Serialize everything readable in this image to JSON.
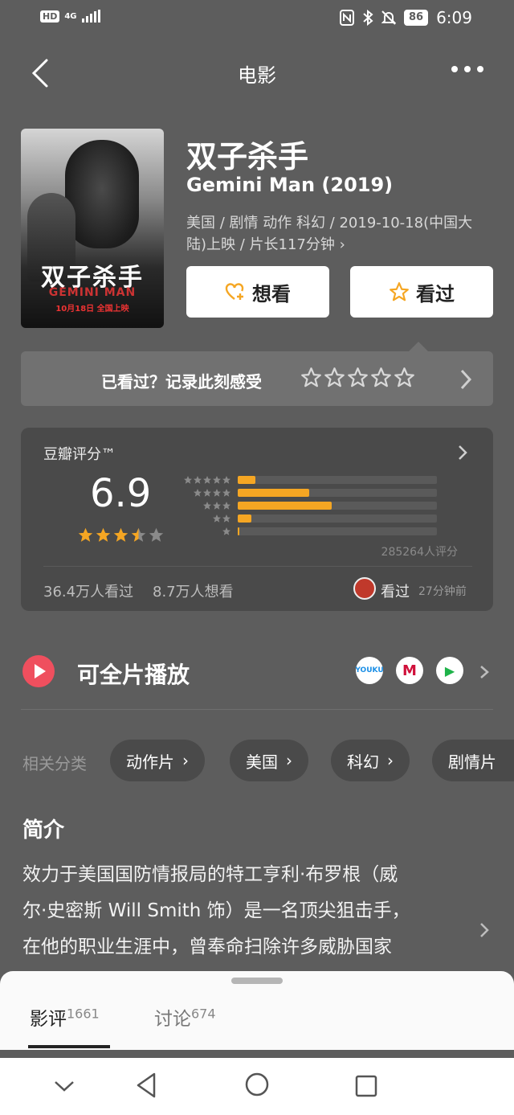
{
  "status_bar": {
    "hd": "HD",
    "network": "4G",
    "battery": "86",
    "time": "6:09"
  },
  "header": {
    "title": "电影"
  },
  "movie": {
    "title": "双子杀手",
    "subtitle": "Gemini Man (2019)",
    "meta_line1": "美国 / 剧情 动作 科幻 / 2019-10-18(中国大",
    "meta_line2": "陆)上映 / 片长117分钟 ›",
    "poster": {
      "title_cn": "双子杀手",
      "title_en": "GEMINI MAN",
      "date": "10月18日 全国上映"
    }
  },
  "actions": {
    "want_label": "想看",
    "seen_label": "看过"
  },
  "feel_bar": {
    "text": "已看过？记录此刻感受"
  },
  "rating": {
    "label": "豆瓣评分™",
    "score": "6.9",
    "star_level": 3.5,
    "distribution": [
      {
        "stars": 5,
        "fraction": 0.09
      },
      {
        "stars": 4,
        "fraction": 0.36
      },
      {
        "stars": 3,
        "fraction": 0.47
      },
      {
        "stars": 2,
        "fraction": 0.07
      },
      {
        "stars": 1,
        "fraction": 0.01
      }
    ],
    "count": "285264人评分",
    "watched": "36.4万人看过",
    "want": "8.7万人想看",
    "friend_status": "看过",
    "friend_time": "27分钟前"
  },
  "play": {
    "label": "可全片播放",
    "platforms": [
      "YOUKU",
      "M",
      "▶"
    ]
  },
  "tags": {
    "label": "相关分类",
    "items": [
      "动作片",
      "美国",
      "科幻",
      "剧情片"
    ]
  },
  "intro": {
    "title": "简介",
    "line1": "效力于美国国防情报局的特工亨利·布罗根（威",
    "line2": "尔·史密斯 Will Smith 饰）是一名顶尖狙击手，",
    "line3": "在他的职业生涯中，曾奉命扫除许多威胁国家"
  },
  "sheet": {
    "tab1_label": "影评",
    "tab1_count": "1661",
    "tab2_label": "讨论",
    "tab2_count": "674"
  },
  "colors": {
    "accent": "#f5a623",
    "play_red": "#ef4f5e",
    "background": "#5d5d5d"
  }
}
